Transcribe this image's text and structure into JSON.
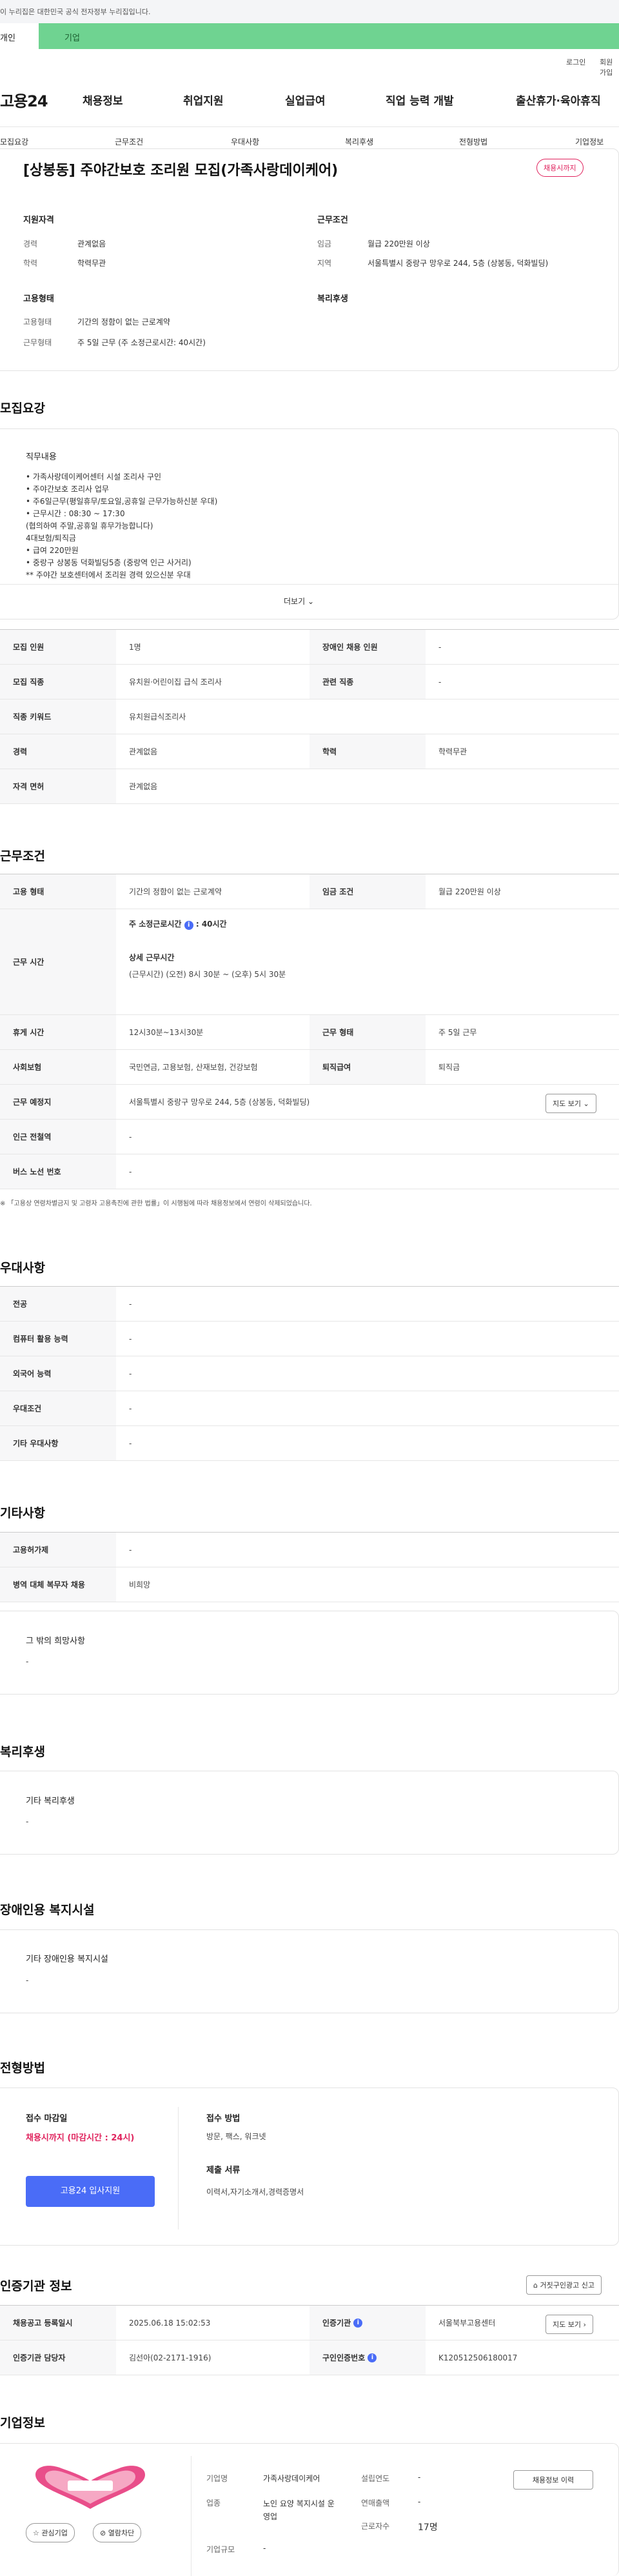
{
  "gov_banner": "이 누리집은 대한민국 공식 전자정부 누리집입니다.",
  "tabs": [
    "개인",
    "기업"
  ],
  "util": [
    "로그인",
    "회원가입"
  ],
  "logo": "고용24",
  "gnb": [
    "채용정보",
    "취업지원",
    "실업급여",
    "직업 능력 개발",
    "출산휴가·육아휴직"
  ],
  "subnav": [
    "모집요강",
    "근무조건",
    "우대사항",
    "복리후생",
    "전형방법",
    "기업정보"
  ],
  "job": {
    "title": "[상봉동] 주야간보호 조리원 모집(가족사랑데이케어)",
    "badge": "채용시까지",
    "qual_head": "지원자격",
    "cond_head": "근무조건",
    "exp_label": "경력",
    "exp_val": "관계없음",
    "edu_label": "학력",
    "edu_val": "학력무관",
    "wage_label": "임금",
    "wage_val": "월급 220만원 이상",
    "area_label": "지역",
    "area_val": "서울특별시 중랑구 망우로 244, 5층 (상봉동, 덕화빌딩)",
    "emp_head": "고용형태",
    "welfare_head": "복리후생",
    "type_label": "고용형태",
    "type_val": "기간의 정함이 없는 근로계약",
    "hours_label": "근무형태",
    "hours_val": "주 5일 근무 (주 소정근로시간: 40시간)"
  },
  "recruit": {
    "heading": "모집요강",
    "duty_head": "직무내용",
    "duty_lines": [
      "• 가족사랑데이케어센터 시설 조리사 구인",
      "• 주야간보호 조리사 업무",
      "• 주6일근무(평일휴무/토요일,공휴일 근무가능하신분 우대)",
      "• 근무시간 : 08:30 ~ 17:30",
      "(협의하여 주말,공휴일 휴무가능합니다)",
      "4대보험/퇴직금",
      "• 급여 220만원",
      "• 중랑구 상봉동 덕화빌딩5층  (중랑역 인근 사거리)",
      "** 주야간 보호센터에서 조리원 경력 있으신분 우대"
    ],
    "more": "더보기",
    "rows": [
      {
        "a": "모집 인원",
        "b": "1명",
        "c": "장애인 채용 인원",
        "d": "-"
      },
      {
        "a": "모집 직종",
        "b": "유치원·어린이집 급식 조리사",
        "c": "관련 직종",
        "d": "-"
      },
      {
        "a": "직종 키워드",
        "b": "유치원급식조리사",
        "c": "",
        "d": ""
      },
      {
        "a": "경력",
        "b": "관계없음",
        "c": "학력",
        "d": "학력무관"
      },
      {
        "a": "자격 면허",
        "b": "관계없음",
        "c": "",
        "d": ""
      }
    ]
  },
  "conditions": {
    "heading": "근무조건",
    "emp_type_l": "고용 형태",
    "emp_type_v": "기간의 정함이 없는 근로계약",
    "wage_l": "임금 조건",
    "wage_v": "월급 220만원 이상",
    "time_l": "근무 시간",
    "week_hours": "주 소정근로시간",
    "week_hours_v": "40시간",
    "detail_head": "상세 근무시간",
    "detail_v": "(근무시간) (오전) 8시 30분 ~ (오후) 5시 30분",
    "break_l": "휴게 시간",
    "break_v": "12시30분~13시30분",
    "form_l": "근무 형태",
    "form_v": "주 5일 근무",
    "ins_l": "사회보험",
    "ins_v": "국민연금, 고용보험, 산재보험, 건강보험",
    "sev_l": "퇴직급여",
    "sev_v": "퇴직금",
    "place_l": "근무 예정지",
    "place_v": "서울특별시 중랑구 망우로 244, 5층 (상봉동, 덕화빌딩)",
    "map_btn": "지도 보기",
    "subway_l": "인근 전철역",
    "subway_v": "-",
    "bus_l": "버스 노선 번호",
    "bus_v": "-",
    "note": "※ 「고용상 연령차별금지 및 고령자 고용촉진에 관한 법률」이 시행됨에 따라 채용정보에서 연령이 삭제되었습니다."
  },
  "prefer": {
    "heading": "우대사항",
    "rows": [
      {
        "l": "전공",
        "v": "-"
      },
      {
        "l": "컴퓨터 활용 능력",
        "v": "-"
      },
      {
        "l": "외국어 능력",
        "v": "-"
      },
      {
        "l": "우대조건",
        "v": "-"
      },
      {
        "l": "기타 우대사항",
        "v": "-"
      }
    ]
  },
  "etc": {
    "heading": "기타사항",
    "rows": [
      {
        "l": "고용허가제",
        "v": "-"
      },
      {
        "l": "병역 대체 복무자 채용",
        "v": "비희망"
      }
    ],
    "other_head": "그 밖의 희망사항",
    "other_v": "-"
  },
  "welfare": {
    "heading": "복리후생",
    "sub": "기타 복리후생",
    "v": "-"
  },
  "disabled": {
    "heading": "장애인용 복지시설",
    "sub": "기타 장애인용 복지시설",
    "v": "-"
  },
  "selection": {
    "heading": "전형방법",
    "deadline_l": "접수 마감일",
    "deadline_v": "채용시까지 (마감시간 : 24시)",
    "apply_btn": "고용24 입사지원",
    "method_l": "접수 방법",
    "method_v": "방문, 팩스, 워크넷",
    "docs_l": "제출 서류",
    "docs_v": "이력서,자기소개서,경력증명서"
  },
  "cert": {
    "heading": "인증기관 정보",
    "report_btn": "거짓구인광고 신고",
    "reg_l": "채용공고 등록일시",
    "reg_v": "2025.06.18 15:02:53",
    "org_l": "인증기관",
    "org_v": "서울북부고용센터",
    "map_btn": "지도 보기",
    "mgr_l": "인증기관 담당자",
    "mgr_v": "김선아(02-2171-1916)",
    "no_l": "구인인증번호",
    "no_v": "K120512506180017"
  },
  "company": {
    "heading": "기업정보",
    "fav_btn": "관심기업",
    "block_btn": "열람차단",
    "name_l": "기업명",
    "name_v": "가족사랑데이케어",
    "ind_l": "업종",
    "ind_v": "노인 요양 복지시설 운영업",
    "size_l": "기업규모",
    "size_v": "-",
    "year_l": "설립연도",
    "year_v": "-",
    "sales_l": "연매출액",
    "sales_v": "-",
    "emp_l": "근로자수",
    "emp_v": "17명",
    "history_btn": "채용정보 이력"
  },
  "colors": {
    "accent_green": "#6fd391",
    "badge_red": "#e0245e",
    "apply_blue": "#4a6cf7"
  }
}
